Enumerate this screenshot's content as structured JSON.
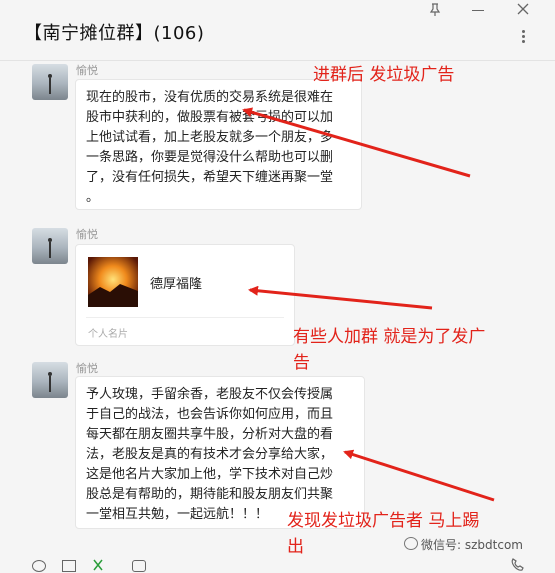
{
  "header": {
    "title": "【南宁摊位群】(106)"
  },
  "messages": [
    {
      "sender": "愉悦",
      "lines": [
        "现在的股市，没有优质的交易系统是很难在",
        "股市中获利的，做股票有被套亏损的可以加",
        "上他试试看，加上老股友就多一个朋友，多",
        "一条思路，你要是觉得没什么帮助也可以删",
        "了，没有任何损失，希望天下缠迷再聚一堂",
        "。"
      ]
    },
    {
      "sender": "愉悦",
      "card": {
        "name": "德厚福隆",
        "type": "个人名片"
      }
    },
    {
      "sender": "愉悦",
      "lines": [
        "予人玫瑰，手留余香，老股友不仅会传授属",
        "于自己的战法，也会告诉你如何应用，而且",
        "每天都在朋友圈共享牛股，分析对大盘的看",
        "法，老股友是真的有技术才会分享给大家，",
        "这是他名片大家加上他，学下技术对自己炒",
        "股总是有帮助的，期待能和股友朋友们共聚",
        "一堂相互共勉，一起远航！！！"
      ]
    }
  ],
  "annotations": [
    {
      "lines": [
        "进群后 发垃圾广告"
      ]
    },
    {
      "lines": [
        "有些人加群 就是为了发广",
        "告"
      ]
    },
    {
      "lines": [
        "发现发垃圾广告者 马上踢",
        "出"
      ]
    }
  ],
  "watermark": "微信号: szbdtcom",
  "colors": {
    "annotation": "#e2231a",
    "background": "#f5f5f5"
  },
  "icons": [
    "pin-icon",
    "minimize-icon",
    "close-icon",
    "more-icon",
    "emoji-icon",
    "folder-icon",
    "scissors-icon",
    "chat-history-icon",
    "voice-call-icon",
    "wechat-logo-icon"
  ]
}
